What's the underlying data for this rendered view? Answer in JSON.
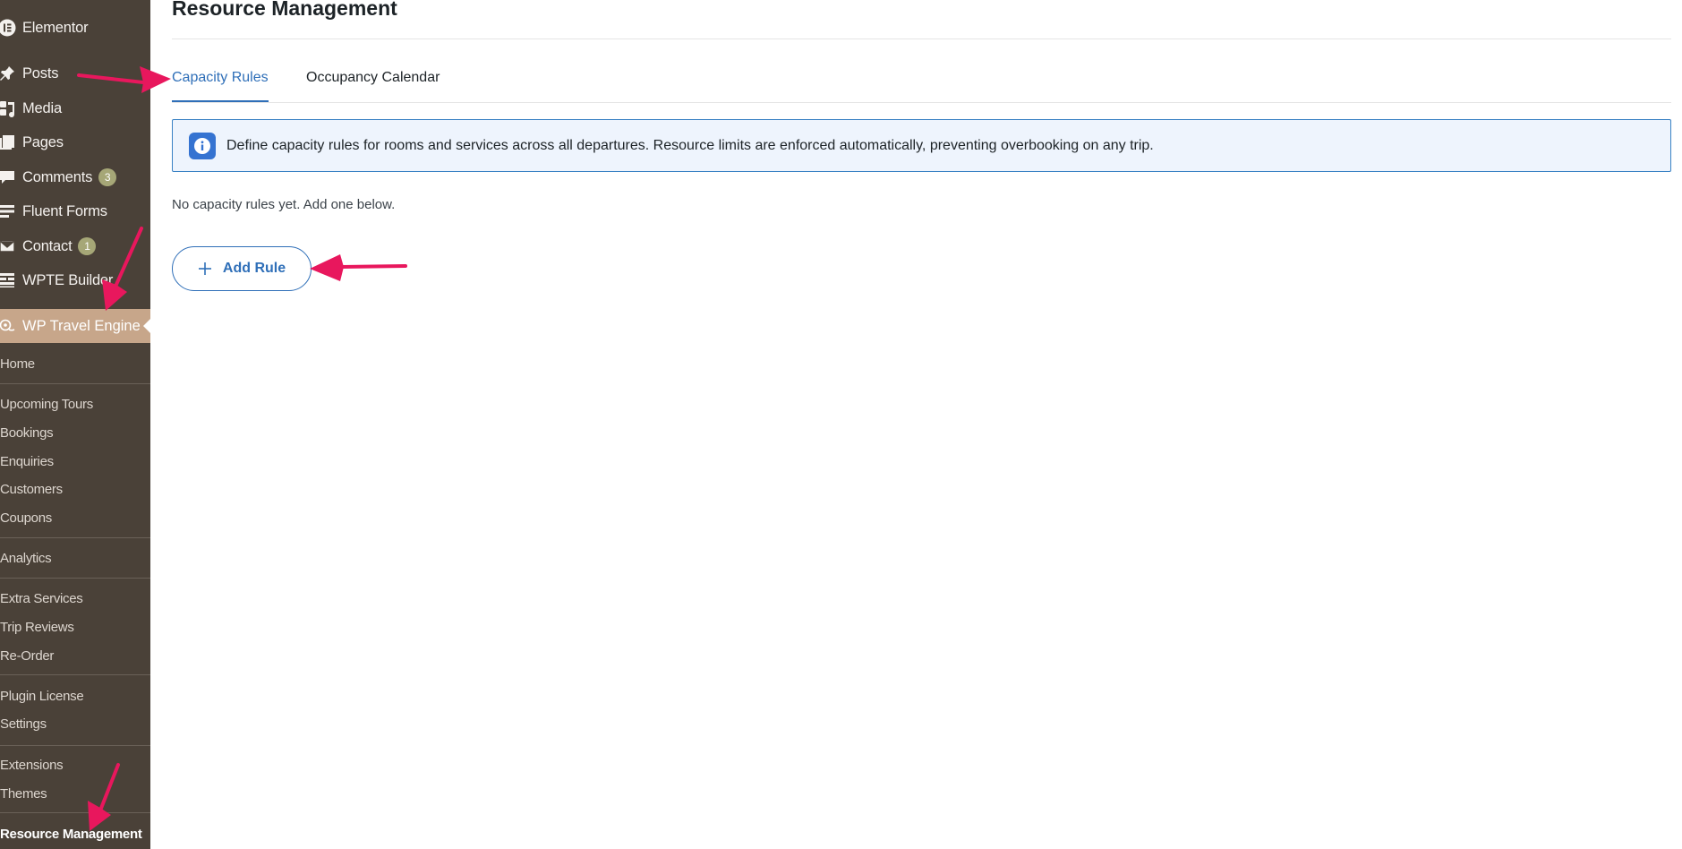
{
  "sidebar": {
    "top_items": [
      {
        "label": "Elementor",
        "icon": "elementor-icon",
        "badge": ""
      },
      {
        "label": "Posts",
        "icon": "pin-icon",
        "badge": ""
      },
      {
        "label": "Media",
        "icon": "media-icon",
        "badge": ""
      },
      {
        "label": "Pages",
        "icon": "pages-icon",
        "badge": ""
      },
      {
        "label": "Comments",
        "icon": "comment-icon",
        "badge": "3"
      },
      {
        "label": "Fluent Forms",
        "icon": "forms-icon",
        "badge": ""
      },
      {
        "label": "Contact",
        "icon": "mail-icon",
        "badge": "1"
      },
      {
        "label": "WPTE Builder",
        "icon": "builder-icon",
        "badge": ""
      }
    ],
    "active_menu": {
      "label": "WP Travel Engine",
      "icon": "travel-engine-icon"
    },
    "sub_items": [
      {
        "label": "Home"
      },
      {
        "label": "Upcoming Tours"
      },
      {
        "label": "Bookings"
      },
      {
        "label": "Enquiries"
      },
      {
        "label": "Customers"
      },
      {
        "label": "Coupons"
      },
      {
        "label": "Analytics"
      },
      {
        "label": "Extra Services"
      },
      {
        "label": "Trip Reviews"
      },
      {
        "label": "Re-Order"
      },
      {
        "label": "Plugin License"
      },
      {
        "label": "Settings"
      },
      {
        "label": "Extensions"
      },
      {
        "label": "Themes"
      },
      {
        "label": "Resource Management"
      }
    ]
  },
  "main": {
    "title": "Resource Management",
    "tabs": [
      {
        "label": "Capacity Rules",
        "active": true
      },
      {
        "label": "Occupancy Calendar",
        "active": false
      }
    ],
    "notice": {
      "icon": "info-icon",
      "text": "Define capacity rules for rooms and services across all departures. Resource limits are enforced automatically, preventing overbooking on any trip."
    },
    "empty_text": "No capacity rules yet. Add one below.",
    "add_rule_label": "Add Rule"
  },
  "colors": {
    "sidebar_bg": "#4a4138",
    "active_menu_bg": "#c7a68a",
    "accent": "#2f6fb8",
    "notice_bg": "#eef4fd",
    "arrow": "#e8175d"
  }
}
